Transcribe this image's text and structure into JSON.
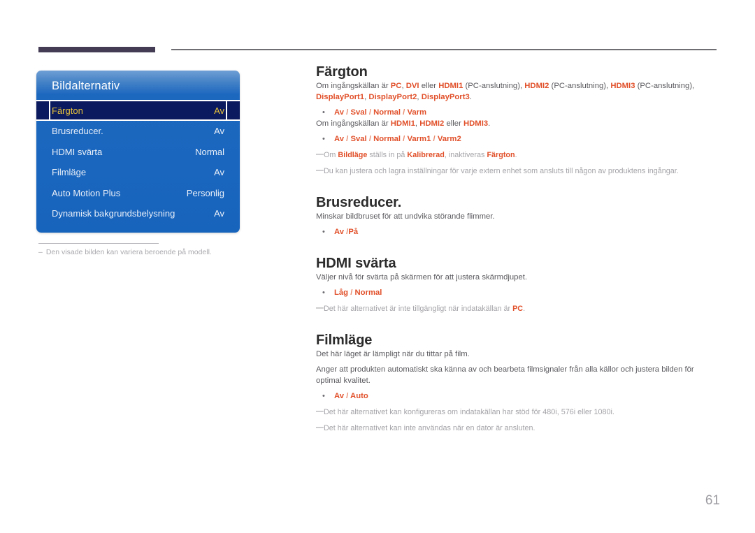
{
  "page": {
    "number": "61"
  },
  "osd": {
    "title": "Bildalternativ",
    "rows": [
      {
        "label": "Färgton",
        "value": "Av",
        "selected": true
      },
      {
        "label": "Brusreducer.",
        "value": "Av",
        "selected": false
      },
      {
        "label": "HDMI svärta",
        "value": "Normal",
        "selected": false
      },
      {
        "label": "Filmläge",
        "value": "Av",
        "selected": false
      },
      {
        "label": "Auto Motion Plus",
        "value": "Personlig",
        "selected": false
      },
      {
        "label": "Dynamisk bakgrundsbelysning",
        "value": "Av",
        "selected": false
      }
    ],
    "note_dash": "–",
    "note": "Den visade bilden kan variera beroende på modell."
  },
  "colors": {
    "accent": "#e1502a",
    "osd_blue": "#1764bd",
    "osd_selected_bg": "#0b1a5e",
    "osd_selected_text": "#e9c33c",
    "rule_dark": "#443c55"
  },
  "sections": {
    "fargton": {
      "heading": "Färgton",
      "para1": {
        "p1": "Om ingångskällan är ",
        "k1": "PC",
        "p2": ", ",
        "k2": "DVI",
        "p3": " eller ",
        "k3": "HDMI1",
        "p4": " (PC-anslutning), ",
        "k4": "HDMI2",
        "p5": " (PC-anslutning), ",
        "k5": "HDMI3",
        "p6": " (PC-anslutning), ",
        "k6": "DisplayPort1",
        "p7": ", ",
        "k7": "DisplayPort2",
        "p8": ", ",
        "k8": "DisplayPort3",
        "p9": "."
      },
      "opt1_bullet": "•",
      "opt1": {
        "a": "Av",
        "s1": " / ",
        "b": "Sval",
        "s2": " / ",
        "c": "Normal",
        "s3": " / ",
        "d": "Varm"
      },
      "para2": {
        "p1": "Om ingångskällan är ",
        "k1": "HDMI1",
        "p2": ", ",
        "k2": "HDMI2",
        "p3": " eller ",
        "k3": "HDMI3",
        "p4": "."
      },
      "opt2_bullet": "•",
      "opt2": {
        "a": "Av",
        "s1": " / ",
        "b": "Sval",
        "s2": " / ",
        "c": "Normal",
        "s3": " / ",
        "d": "Varm1",
        "s4": " / ",
        "e": "Varm2"
      },
      "note1_dash": "―",
      "note1": {
        "p1": "Om ",
        "k1": "Bildläge",
        "p2": " ställs in på ",
        "k2": "Kalibrerad",
        "p3": ", inaktiveras ",
        "k3": "Färgton",
        "p4": "."
      },
      "note2_dash": "―",
      "note2": "Du kan justera och lagra inställningar för varje extern enhet som ansluts till någon av produktens ingångar."
    },
    "brusreducer": {
      "heading": "Brusreducer.",
      "para1": "Minskar bildbruset för att undvika störande flimmer.",
      "opt_bullet": "•",
      "opt": {
        "a": "Av",
        "s1": " /",
        "b": "På"
      }
    },
    "hdmi_svarta": {
      "heading": "HDMI svärta",
      "para1": "Väljer nivå för svärta på skärmen för att justera skärmdjupet.",
      "opt_bullet": "•",
      "opt": {
        "a": "Låg",
        "s1": " / ",
        "b": "Normal"
      },
      "note_dash": "―",
      "note": {
        "p1": "Det här alternativet är inte tillgängligt när indatakällan är ",
        "k1": "PC",
        "p2": "."
      }
    },
    "filmlage": {
      "heading": "Filmläge",
      "para1": "Det här läget är lämpligt när du tittar på film.",
      "para2": "Anger att produkten automatiskt ska känna av och bearbeta filmsignaler från alla källor och justera bilden för optimal kvalitet.",
      "opt_bullet": "•",
      "opt": {
        "a": "Av",
        "s1": " / ",
        "b": "Auto"
      },
      "note1_dash": "―",
      "note1": "Det här alternativet kan konfigureras om indatakällan har stöd för 480i, 576i eller 1080i.",
      "note2_dash": "―",
      "note2": "Det här alternativet kan inte användas när en dator är ansluten."
    }
  }
}
